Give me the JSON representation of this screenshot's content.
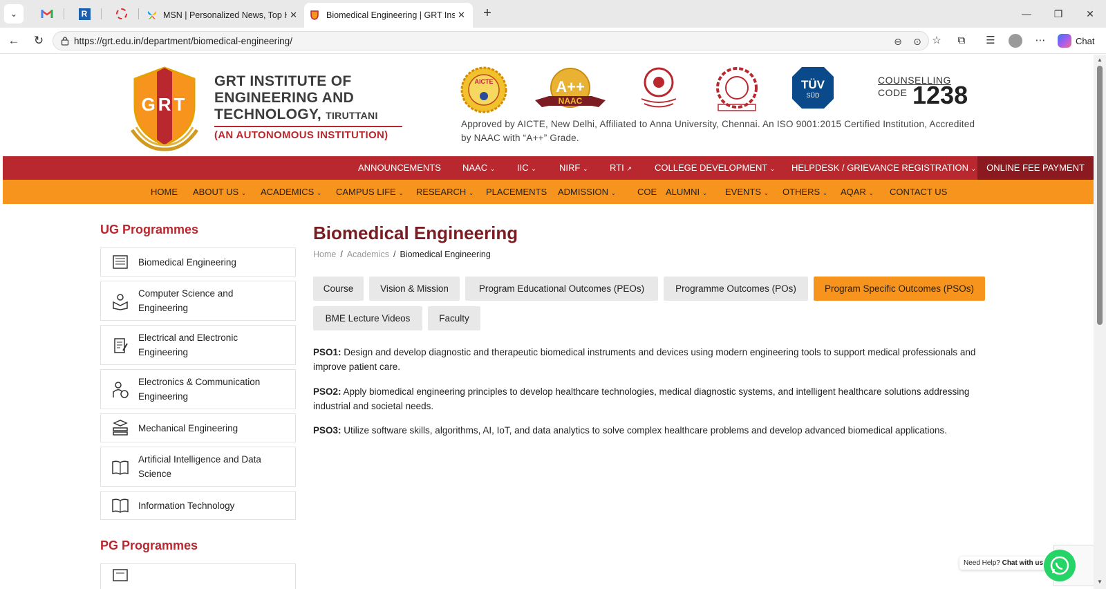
{
  "browser": {
    "tabs": [
      {
        "title": "MSN | Personalized News, Top Hea"
      },
      {
        "title": "Biomedical Engineering | GRT Insti",
        "active": true
      }
    ],
    "url": "https://grt.edu.in/department/biomedical-engineering/",
    "chat_label": "Chat"
  },
  "header": {
    "logo_text": "GRT",
    "name_line1": "GRT INSTITUTE OF",
    "name_line2": "ENGINEERING AND",
    "name_line3": "TECHNOLOGY,",
    "name_city": "TIRUTTANI",
    "subtitle": "(AN AUTONOMOUS INSTITUTION)",
    "accreditation": {
      "aicte": "AICTE",
      "naac_grade": "A++",
      "naac": "NAAC",
      "tuv": "TÜV",
      "tuv_sub": "SÜD"
    },
    "counselling_line1": "COUNSELLING",
    "counselling_line2": "CODE",
    "counselling_code": "1238",
    "approved_text": "Approved by AICTE, New Delhi, Affiliated to Anna University, Chennai. An ISO 9001:2015 Certified Institution, Accredited by NAAC with “A++” Grade."
  },
  "top_nav": {
    "items": [
      "ANNOUNCEMENTS",
      "NAAC",
      "IIC",
      "NIRF",
      "RTI",
      "COLLEGE DEVELOPMENT",
      "HELPDESK / GRIEVANCE REGISTRATION"
    ],
    "fee_button": "ONLINE FEE PAYMENT"
  },
  "main_nav": {
    "items": [
      "HOME",
      "ABOUT US",
      "ACADEMICS",
      "CAMPUS LIFE",
      "RESEARCH",
      "PLACEMENTS",
      "ADMISSION",
      "COE",
      "ALUMNI",
      "EVENTS",
      "OTHERS",
      "AQAR",
      "CONTACT US"
    ]
  },
  "sidebar": {
    "ug_heading": "UG Programmes",
    "ug_items": [
      "Biomedical Engineering",
      "Computer Science and Engineering",
      "Electrical and Electronic Engineering",
      "Electronics & Communication Engineering",
      "Mechanical Engineering",
      "Artificial Intelligence and Data Science",
      "Information Technology"
    ],
    "pg_heading": "PG Programmes"
  },
  "main": {
    "title": "Biomedical Engineering",
    "breadcrumb": [
      "Home",
      "Academics",
      "Biomedical Engineering"
    ],
    "tabs": [
      "Course",
      "Vision & Mission",
      "Program Educational Outcomes (PEOs)",
      "Programme Outcomes (POs)",
      "Program Specific Outcomes (PSOs)",
      "BME Lecture Videos",
      "Faculty"
    ],
    "active_tab": "Program Specific Outcomes (PSOs)",
    "psos": [
      {
        "label": "PSO1:",
        "text": "Design and develop diagnostic and therapeutic biomedical instruments and devices using modern engineering tools to support medical professionals and improve patient care."
      },
      {
        "label": "PSO2:",
        "text": "Apply biomedical engineering principles to develop healthcare technologies, medical diagnostic systems, and intelligent healthcare solutions addressing industrial and societal needs."
      },
      {
        "label": "PSO3:",
        "text": "Utilize software skills, algorithms, AI, IoT, and data analytics to solve complex healthcare problems and develop advanced biomedical applications."
      }
    ]
  },
  "whatsapp": {
    "need_help": "Need Help?",
    "chat_with_us": "Chat with us"
  },
  "colors": {
    "brand_red": "#b9282e",
    "brand_orange": "#f7941d",
    "title_maroon": "#7a1c22"
  }
}
